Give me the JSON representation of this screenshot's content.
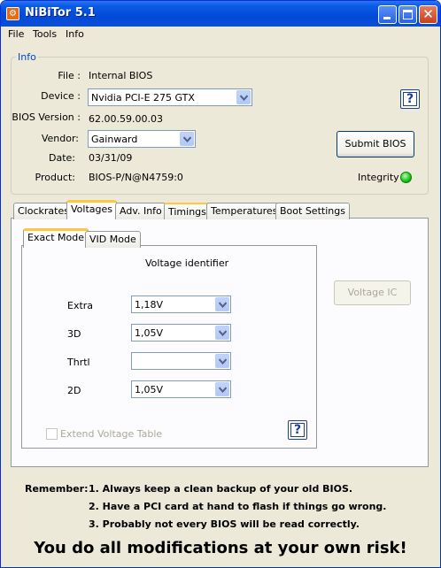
{
  "window": {
    "title": "NiBiTor 5.1",
    "app_icon_glyph": "⚙",
    "close_glyph": "✕"
  },
  "menu": {
    "items": [
      "File",
      "Tools",
      "Info"
    ]
  },
  "info": {
    "group_title": "Info",
    "file_label": "File :",
    "file_value": "Internal BIOS",
    "device_label": "Device :",
    "device_value": "Nvidia PCI-E 275 GTX",
    "bios_version_label": "BIOS Version :",
    "bios_version_value": "62.00.59.00.03",
    "vendor_label": "Vendor:",
    "vendor_value": "Gainward",
    "date_label": "Date:",
    "date_value": "03/31/09",
    "product_label": "Product:",
    "product_value": "BIOS-P/N@N4759:0",
    "help_label": "?",
    "submit_label": "Submit BIOS",
    "integrity_label": "Integrity :",
    "integrity_color": "#16c216"
  },
  "tabs": {
    "items": [
      "Clockrates",
      "Voltages",
      "Adv. Info",
      "Timings",
      "Temperatures",
      "Boot Settings"
    ],
    "active": "Voltages"
  },
  "subtabs": {
    "items": [
      "Exact Mode",
      "VID Mode"
    ],
    "active": "Exact Mode"
  },
  "voltages": {
    "heading": "Voltage identifier",
    "rows": [
      {
        "label": "Extra",
        "value": "1,18V"
      },
      {
        "label": "3D",
        "value": "1,05V"
      },
      {
        "label": "Thrtl",
        "value": ""
      },
      {
        "label": "2D",
        "value": "1,05V"
      }
    ],
    "extend_label": "Extend Voltage Table",
    "extend_checked": false,
    "voltage_ic_label": "Voltage IC",
    "help_label": "?"
  },
  "footer": {
    "remember_label": "Remember:",
    "lines": [
      "1. Always keep a clean backup of your old BIOS.",
      "2. Have a PCI card at hand to flash if things go wrong.",
      "3. Probably not every BIOS will be read correctly."
    ],
    "warning": "You do all modifications at your own risk!"
  }
}
